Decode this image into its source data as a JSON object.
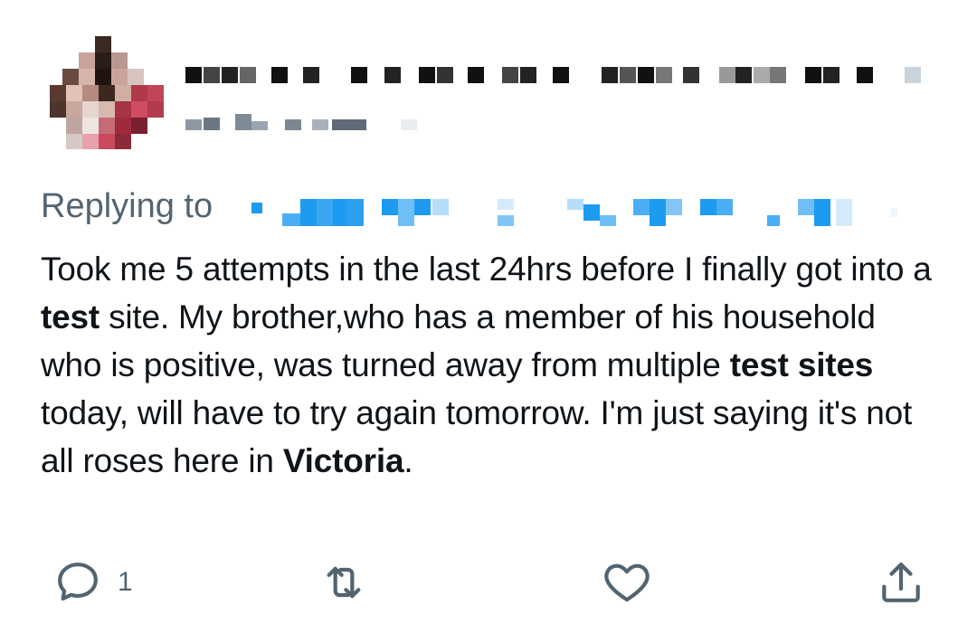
{
  "reply": {
    "prefix": "Replying to"
  },
  "tweet": {
    "text_parts": [
      {
        "text": "Took me 5 attempts in the last 24hrs before I finally got into a ",
        "bold": false
      },
      {
        "text": "test",
        "bold": true
      },
      {
        "text": " site. My brother,who has a member of his household who is positive, was turned away from multiple ",
        "bold": false
      },
      {
        "text": "test sites",
        "bold": true
      },
      {
        "text": " today, will have to try again tomorrow. I'm just saying it's not all roses here in ",
        "bold": false
      },
      {
        "text": "Victoria",
        "bold": true
      },
      {
        "text": ".",
        "bold": false
      }
    ]
  },
  "actions": {
    "reply_icon": "comment-icon",
    "reply_count": "1",
    "retweet_icon": "retweet-icon",
    "like_icon": "heart-icon",
    "share_icon": "share-icon"
  },
  "colors": {
    "text": "#0f1419",
    "secondary": "#536471",
    "link_blurred": "#1d9bf0"
  }
}
